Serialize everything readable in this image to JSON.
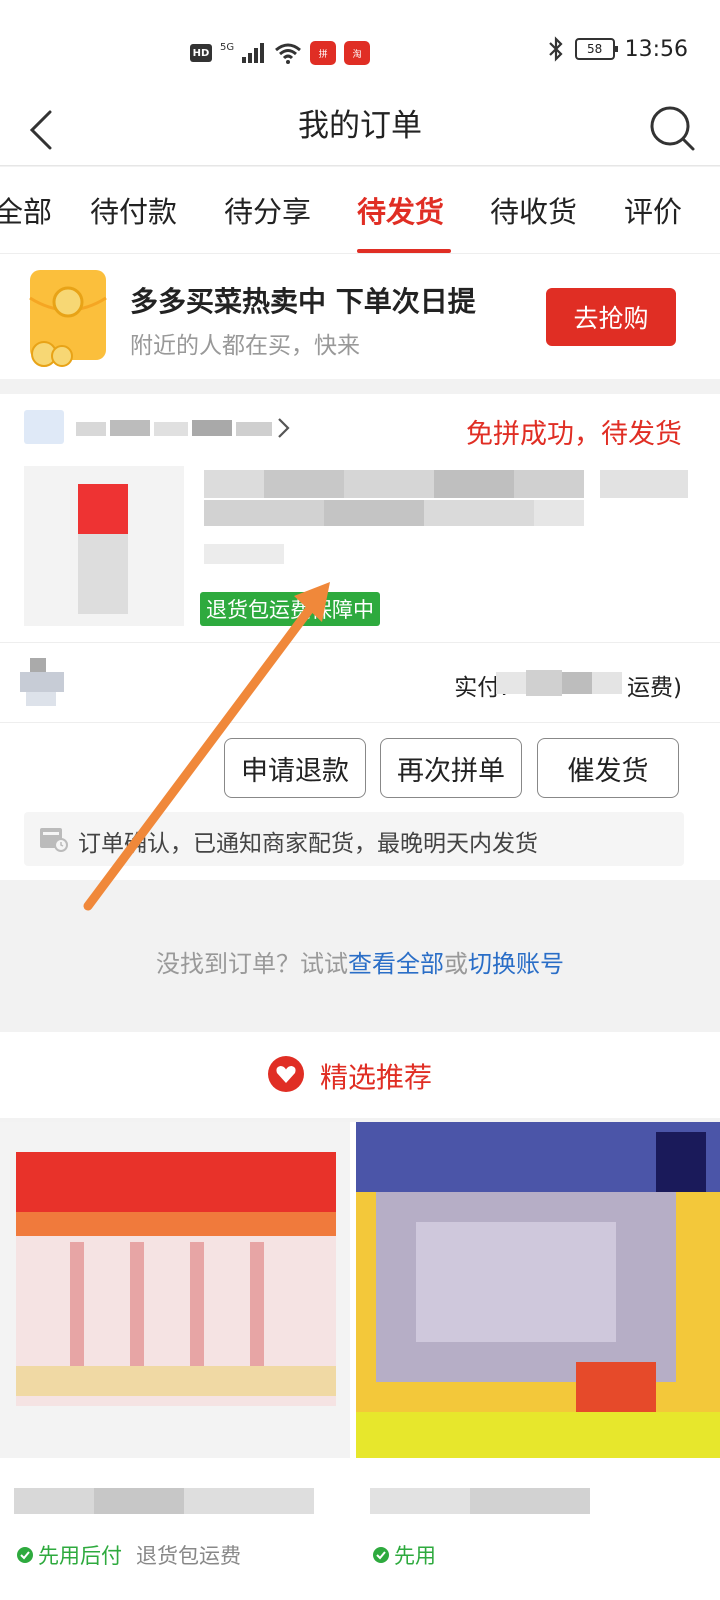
{
  "status_bar": {
    "hd": "HD",
    "signal": "5G",
    "app1": "拼",
    "app2": "淘",
    "battery": "58",
    "time": "13:56"
  },
  "header": {
    "title": "我的订单"
  },
  "tabs": [
    {
      "label": "全部",
      "active": false
    },
    {
      "label": "待付款",
      "active": false
    },
    {
      "label": "待分享",
      "active": false
    },
    {
      "label": "待发货",
      "active": true
    },
    {
      "label": "待收货",
      "active": false
    },
    {
      "label": "评价",
      "active": false
    }
  ],
  "promo": {
    "title": "多多买菜热卖中 下单次日提",
    "subtitle": "附近的人都在买，快来",
    "button": "去抢购"
  },
  "order": {
    "status": "免拼成功，待发货",
    "guarantee": "退货包运费保障中",
    "paid_label": "实付:",
    "paid_suffix": "运费)",
    "buttons": {
      "refund": "申请退款",
      "reorder": "再次拼单",
      "urge": "催发货"
    },
    "notice": "订单确认，已通知商家配货，最晚明天内发货"
  },
  "not_found": {
    "prefix": "没找到订单？试试",
    "link_all": "查看全部",
    "or": "或",
    "link_switch": "切换账号"
  },
  "recommend": {
    "title": "精选推荐",
    "items": [
      {
        "tag1": "先用后付",
        "tag2": "退货包运费"
      },
      {
        "tag1": "先用",
        "tag2": ""
      }
    ]
  },
  "colors": {
    "brand_red": "#e02e24",
    "green": "#2eaa3e",
    "link_blue": "#2a6ec7",
    "arrow_orange": "#f0883a"
  }
}
